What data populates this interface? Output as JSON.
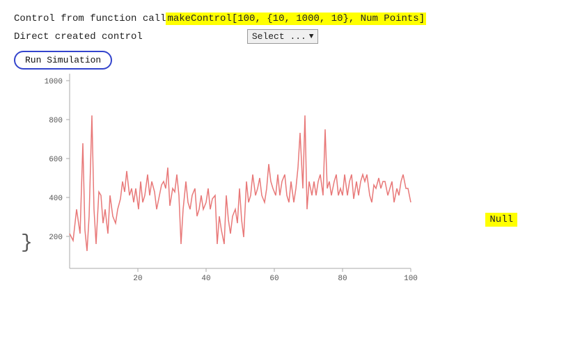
{
  "header": {
    "line1_prefix": "Control from function call ",
    "line1_highlight": "makeControl[100, {10, 1000, 10}, Num Points]",
    "line2_prefix": "Direct created control",
    "select_label": "Select ...",
    "run_button_label": "Run Simulation"
  },
  "null_badge": "Null",
  "chart": {
    "y_labels": [
      "1000",
      "800",
      "600",
      "400",
      "200"
    ],
    "x_labels": [
      "20",
      "40",
      "60",
      "80",
      "100"
    ],
    "line_color": "#e87878"
  }
}
